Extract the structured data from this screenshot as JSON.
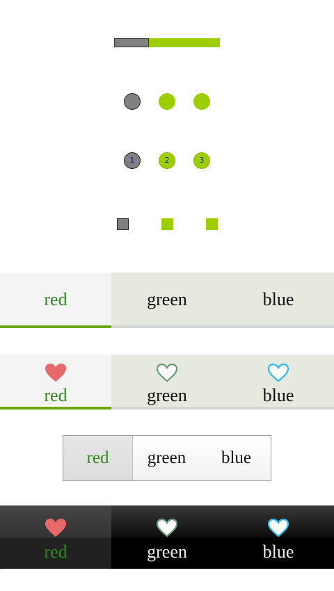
{
  "progress": {
    "value": 0.33
  },
  "page_indicators": {
    "dots": {
      "count": 3,
      "selected_index": 0
    },
    "numbered_dots": {
      "labels": [
        "1",
        "2",
        "3"
      ],
      "selected_index": 0
    },
    "squares": {
      "count": 3,
      "selected_index": 0
    }
  },
  "tabbar_text": {
    "tabs": [
      {
        "label": "red"
      },
      {
        "label": "green"
      },
      {
        "label": "blue"
      }
    ],
    "selected_index": 0
  },
  "tabbar_icons": {
    "tabs": [
      {
        "label": "red",
        "icon": "heart-filled-icon"
      },
      {
        "label": "green",
        "icon": "heart-outline-icon"
      },
      {
        "label": "blue",
        "icon": "heart-outline-icon"
      }
    ],
    "selected_index": 0
  },
  "segmented": {
    "tabs": [
      {
        "label": "red"
      },
      {
        "label": "green"
      },
      {
        "label": "blue"
      }
    ],
    "selected_index": 0
  },
  "tabbar_dark": {
    "tabs": [
      {
        "label": "red",
        "icon": "heart-filled-icon"
      },
      {
        "label": "green",
        "icon": "heart-outline-icon"
      },
      {
        "label": "blue",
        "icon": "heart-outline-icon"
      }
    ],
    "selected_index": 0
  },
  "colors": {
    "accent_green": "#9fce00",
    "selected_text": "#2e8b1e",
    "heart_red": "#e8696b",
    "heart_green": "#6b9a78",
    "heart_blue": "#34b6f0"
  }
}
